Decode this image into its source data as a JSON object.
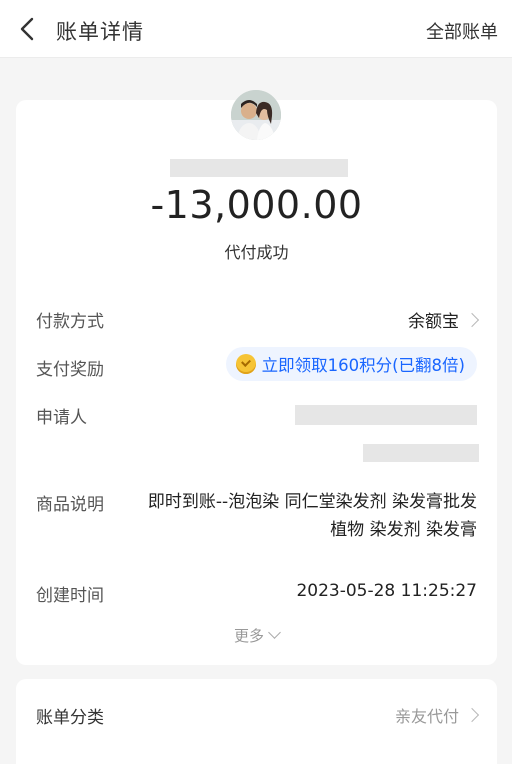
{
  "header": {
    "title": "账单详情",
    "right_link": "全部账单"
  },
  "bill": {
    "amount": "-13,000.00",
    "status": "代付成功",
    "payment_method_label": "付款方式",
    "payment_method_value": "余额宝",
    "reward_label": "支付奖励",
    "reward_value": "立即领取160积分(已翻8倍)",
    "applicant_label": "申请人",
    "product_label": "商品说明",
    "product_value": "即时到账--泡泡染 同仁堂染发剂 染发膏批发植物 染发剂 染发膏",
    "created_label": "创建时间",
    "created_value": "2023-05-28 11:25:27",
    "more_label": "更多"
  },
  "category": {
    "label": "账单分类",
    "value": "亲友代付"
  },
  "colors": {
    "accent": "#1a66ff",
    "reward_bg": "#eef4ff",
    "background": "#f5f5f5"
  }
}
